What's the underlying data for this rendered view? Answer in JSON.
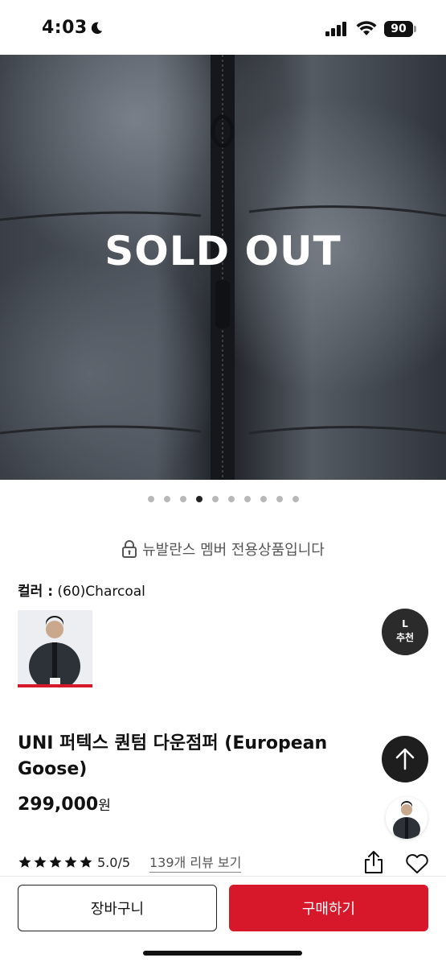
{
  "status_bar": {
    "time": "4:03",
    "battery": "90",
    "icons": [
      "moon-icon",
      "signal-icon",
      "wifi-icon",
      "battery-icon"
    ]
  },
  "hero": {
    "overlay_text": "SOLD OUT",
    "image_description_icon": "jacket-photo",
    "pagination": {
      "total": 10,
      "active_index": 3
    }
  },
  "member_notice": {
    "icon": "lock-icon",
    "text": "뉴발란스 멤버 전용상품입니다"
  },
  "color": {
    "label": "컬러 :",
    "value": "(60)Charcoal"
  },
  "size_badge": {
    "size": "L",
    "label": "추천"
  },
  "product": {
    "title": "UNI 퍼텍스 퀀텀 다운점퍼 (European Goose)",
    "price": "299,000",
    "price_unit": "원"
  },
  "rating": {
    "stars": 5,
    "score": "5.0/5",
    "review_link": "139개 리뷰 보기"
  },
  "actions": {
    "cart_label": "장바구니",
    "buy_label": "구매하기"
  },
  "colors": {
    "accent": "#d6182a",
    "dark": "#1e1e1e"
  }
}
